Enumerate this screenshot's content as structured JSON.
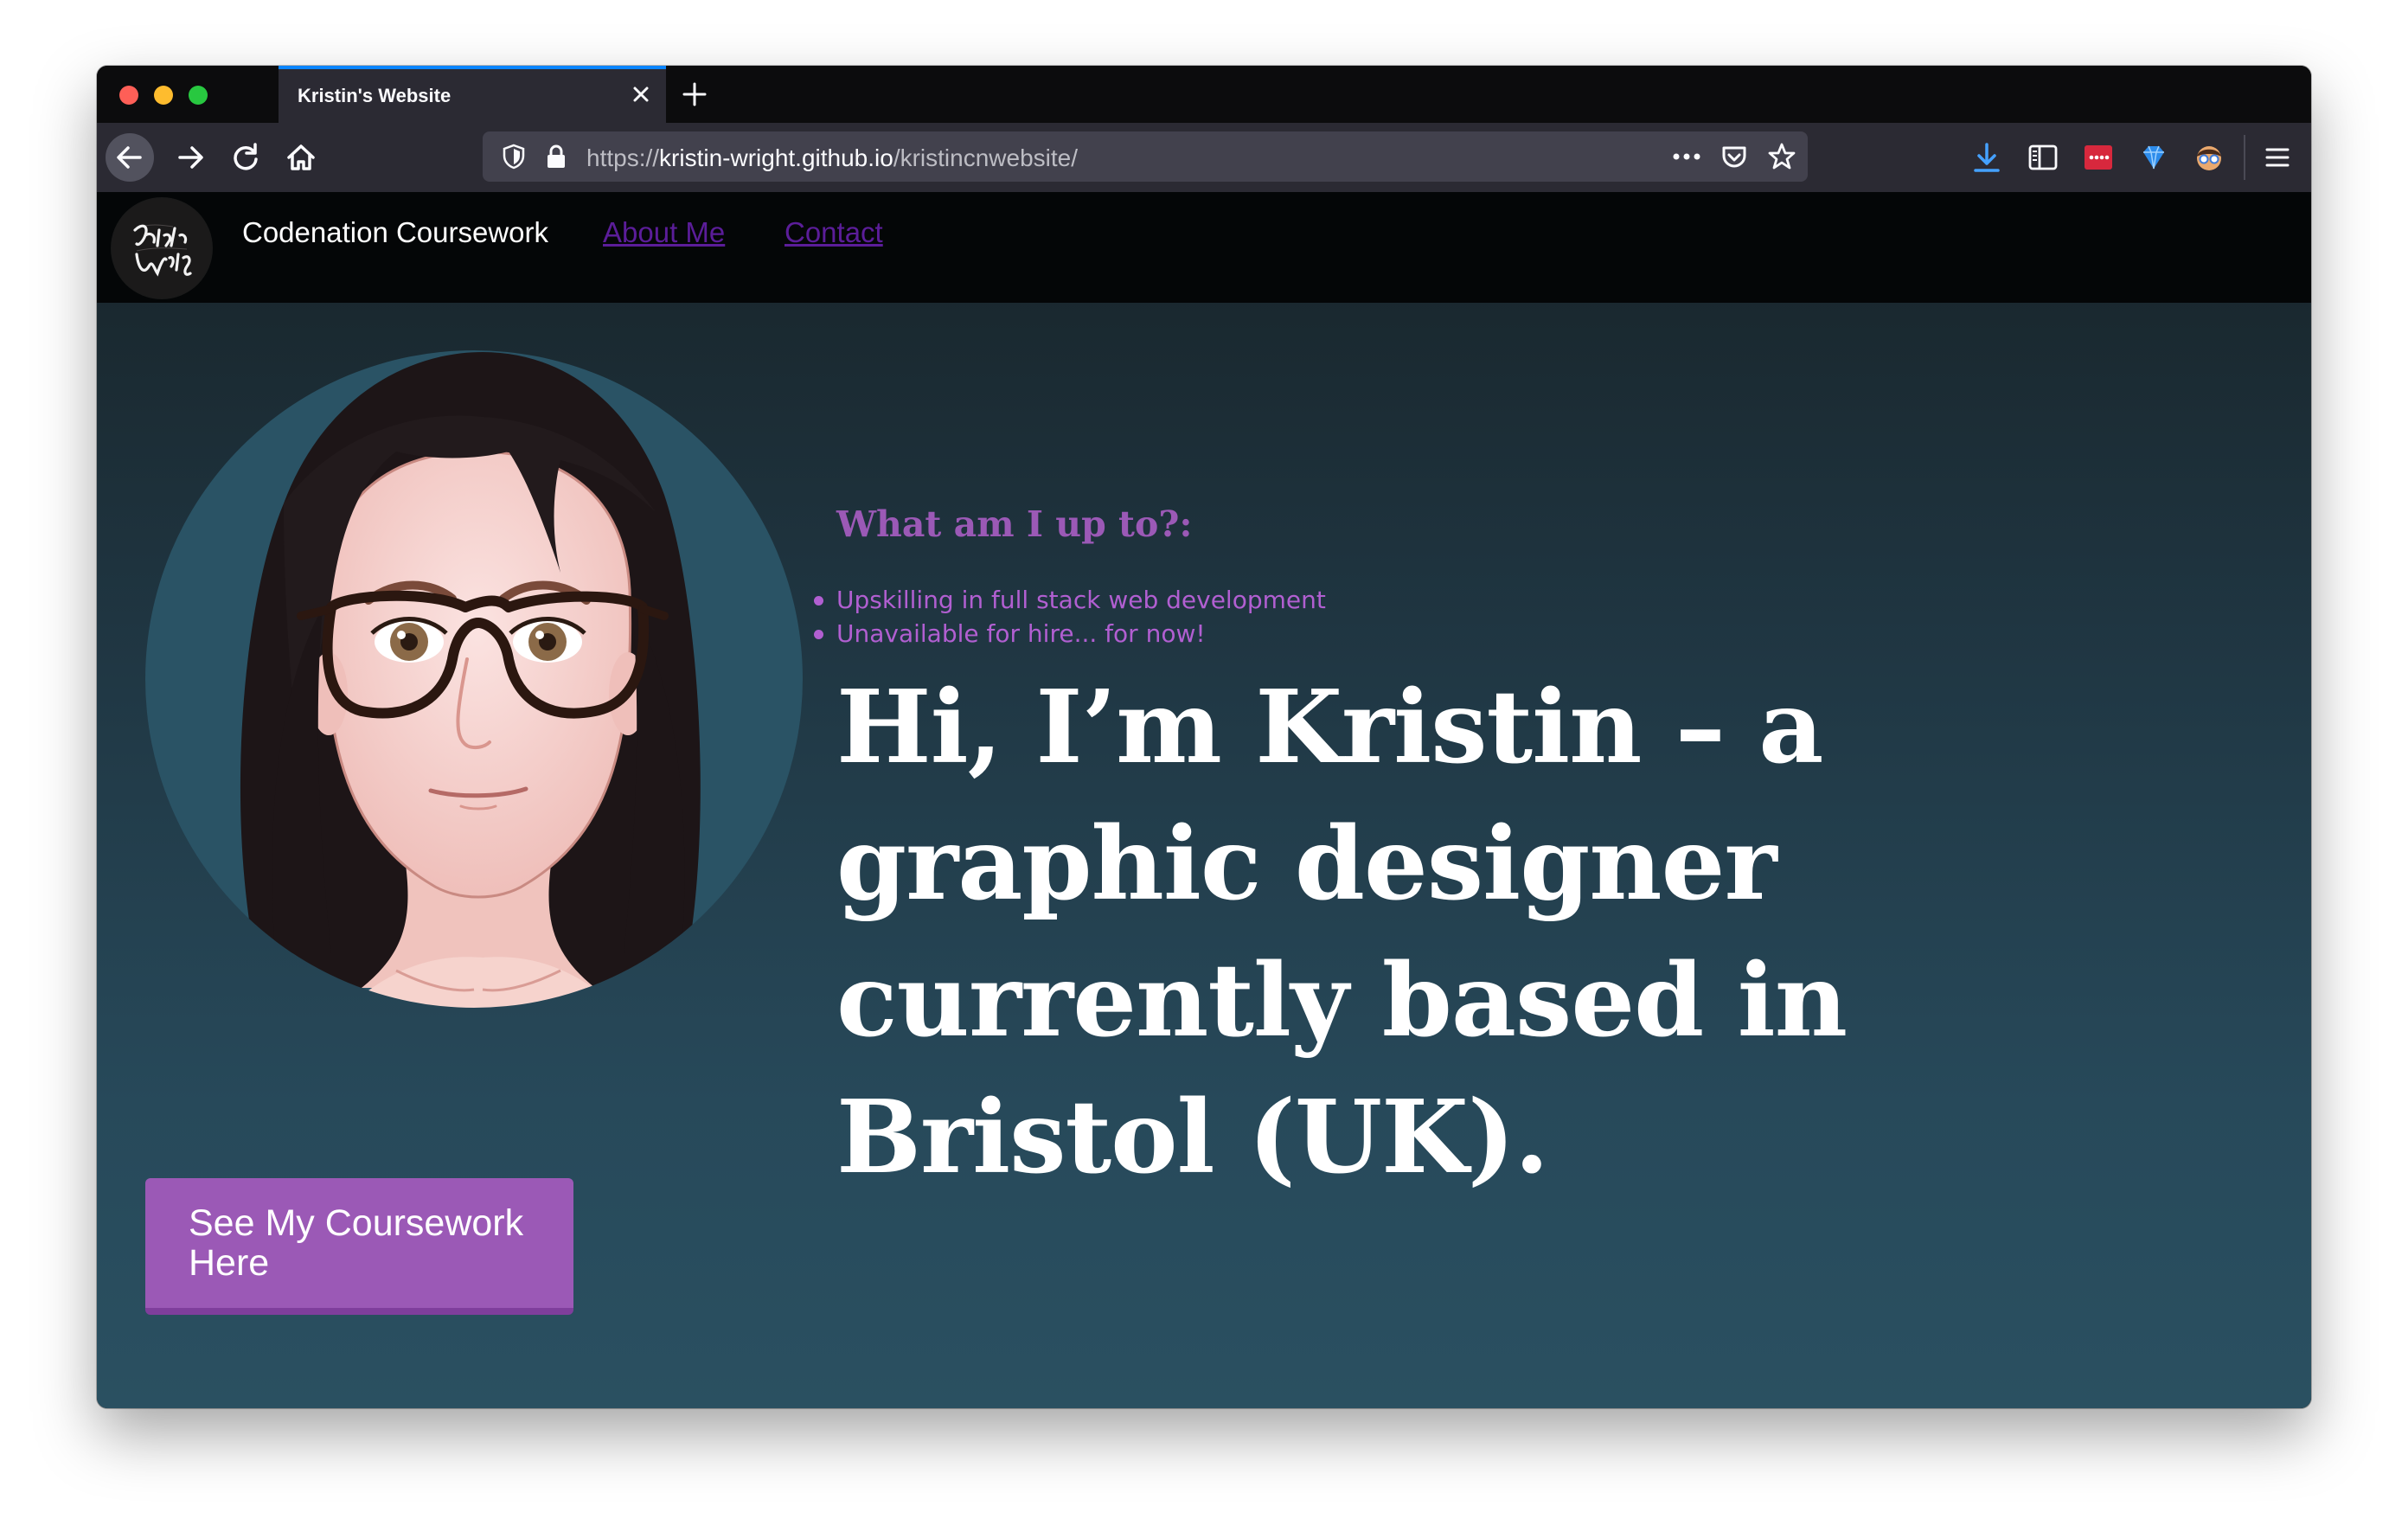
{
  "browser": {
    "tab_title": "Kristin's Website",
    "url_prefix": "https://",
    "url_host": "kristin-wright.github.io",
    "url_path": "/kristincnwebsite/"
  },
  "site": {
    "logo_text": "Kristin Wright",
    "brand": "Codenation Coursework",
    "nav": [
      {
        "label": "About Me"
      },
      {
        "label": "Contact"
      }
    ],
    "up_to_heading": "What am I up to?:",
    "up_to_items": [
      "Upskilling in full stack web development",
      "Unavailable for hire... for now!"
    ],
    "hero_text": "Hi, I’m Kristin – a graphic designer currently based in Bristol (UK).",
    "cta_label": "See My Coursework Here"
  },
  "colors": {
    "accent_purple": "#9b59b6",
    "link_purple": "#5b1d99",
    "header_black": "#040607",
    "focus_blue": "#0a84ff"
  }
}
